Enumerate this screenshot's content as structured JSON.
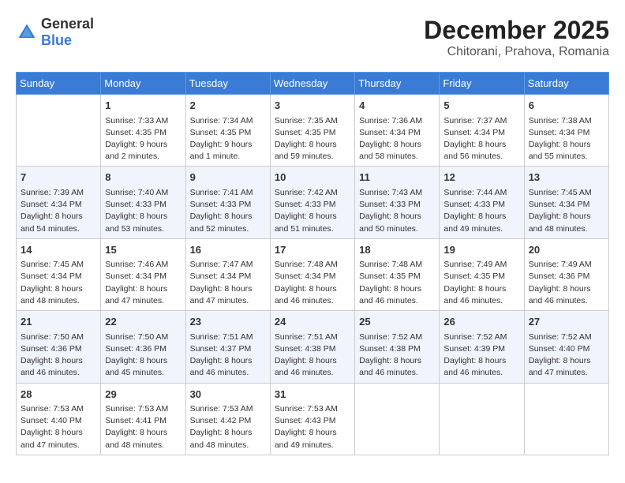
{
  "header": {
    "logo_general": "General",
    "logo_blue": "Blue",
    "main_title": "December 2025",
    "subtitle": "Chitorani, Prahova, Romania"
  },
  "days_of_week": [
    "Sunday",
    "Monday",
    "Tuesday",
    "Wednesday",
    "Thursday",
    "Friday",
    "Saturday"
  ],
  "weeks": [
    [
      {
        "day": "",
        "sunrise": "",
        "sunset": "",
        "daylight": ""
      },
      {
        "day": "1",
        "sunrise": "Sunrise: 7:33 AM",
        "sunset": "Sunset: 4:35 PM",
        "daylight": "Daylight: 9 hours and 2 minutes."
      },
      {
        "day": "2",
        "sunrise": "Sunrise: 7:34 AM",
        "sunset": "Sunset: 4:35 PM",
        "daylight": "Daylight: 9 hours and 1 minute."
      },
      {
        "day": "3",
        "sunrise": "Sunrise: 7:35 AM",
        "sunset": "Sunset: 4:35 PM",
        "daylight": "Daylight: 8 hours and 59 minutes."
      },
      {
        "day": "4",
        "sunrise": "Sunrise: 7:36 AM",
        "sunset": "Sunset: 4:34 PM",
        "daylight": "Daylight: 8 hours and 58 minutes."
      },
      {
        "day": "5",
        "sunrise": "Sunrise: 7:37 AM",
        "sunset": "Sunset: 4:34 PM",
        "daylight": "Daylight: 8 hours and 56 minutes."
      },
      {
        "day": "6",
        "sunrise": "Sunrise: 7:38 AM",
        "sunset": "Sunset: 4:34 PM",
        "daylight": "Daylight: 8 hours and 55 minutes."
      }
    ],
    [
      {
        "day": "7",
        "sunrise": "Sunrise: 7:39 AM",
        "sunset": "Sunset: 4:34 PM",
        "daylight": "Daylight: 8 hours and 54 minutes."
      },
      {
        "day": "8",
        "sunrise": "Sunrise: 7:40 AM",
        "sunset": "Sunset: 4:33 PM",
        "daylight": "Daylight: 8 hours and 53 minutes."
      },
      {
        "day": "9",
        "sunrise": "Sunrise: 7:41 AM",
        "sunset": "Sunset: 4:33 PM",
        "daylight": "Daylight: 8 hours and 52 minutes."
      },
      {
        "day": "10",
        "sunrise": "Sunrise: 7:42 AM",
        "sunset": "Sunset: 4:33 PM",
        "daylight": "Daylight: 8 hours and 51 minutes."
      },
      {
        "day": "11",
        "sunrise": "Sunrise: 7:43 AM",
        "sunset": "Sunset: 4:33 PM",
        "daylight": "Daylight: 8 hours and 50 minutes."
      },
      {
        "day": "12",
        "sunrise": "Sunrise: 7:44 AM",
        "sunset": "Sunset: 4:33 PM",
        "daylight": "Daylight: 8 hours and 49 minutes."
      },
      {
        "day": "13",
        "sunrise": "Sunrise: 7:45 AM",
        "sunset": "Sunset: 4:34 PM",
        "daylight": "Daylight: 8 hours and 48 minutes."
      }
    ],
    [
      {
        "day": "14",
        "sunrise": "Sunrise: 7:45 AM",
        "sunset": "Sunset: 4:34 PM",
        "daylight": "Daylight: 8 hours and 48 minutes."
      },
      {
        "day": "15",
        "sunrise": "Sunrise: 7:46 AM",
        "sunset": "Sunset: 4:34 PM",
        "daylight": "Daylight: 8 hours and 47 minutes."
      },
      {
        "day": "16",
        "sunrise": "Sunrise: 7:47 AM",
        "sunset": "Sunset: 4:34 PM",
        "daylight": "Daylight: 8 hours and 47 minutes."
      },
      {
        "day": "17",
        "sunrise": "Sunrise: 7:48 AM",
        "sunset": "Sunset: 4:34 PM",
        "daylight": "Daylight: 8 hours and 46 minutes."
      },
      {
        "day": "18",
        "sunrise": "Sunrise: 7:48 AM",
        "sunset": "Sunset: 4:35 PM",
        "daylight": "Daylight: 8 hours and 46 minutes."
      },
      {
        "day": "19",
        "sunrise": "Sunrise: 7:49 AM",
        "sunset": "Sunset: 4:35 PM",
        "daylight": "Daylight: 8 hours and 46 minutes."
      },
      {
        "day": "20",
        "sunrise": "Sunrise: 7:49 AM",
        "sunset": "Sunset: 4:36 PM",
        "daylight": "Daylight: 8 hours and 46 minutes."
      }
    ],
    [
      {
        "day": "21",
        "sunrise": "Sunrise: 7:50 AM",
        "sunset": "Sunset: 4:36 PM",
        "daylight": "Daylight: 8 hours and 46 minutes."
      },
      {
        "day": "22",
        "sunrise": "Sunrise: 7:50 AM",
        "sunset": "Sunset: 4:36 PM",
        "daylight": "Daylight: 8 hours and 45 minutes."
      },
      {
        "day": "23",
        "sunrise": "Sunrise: 7:51 AM",
        "sunset": "Sunset: 4:37 PM",
        "daylight": "Daylight: 8 hours and 46 minutes."
      },
      {
        "day": "24",
        "sunrise": "Sunrise: 7:51 AM",
        "sunset": "Sunset: 4:38 PM",
        "daylight": "Daylight: 8 hours and 46 minutes."
      },
      {
        "day": "25",
        "sunrise": "Sunrise: 7:52 AM",
        "sunset": "Sunset: 4:38 PM",
        "daylight": "Daylight: 8 hours and 46 minutes."
      },
      {
        "day": "26",
        "sunrise": "Sunrise: 7:52 AM",
        "sunset": "Sunset: 4:39 PM",
        "daylight": "Daylight: 8 hours and 46 minutes."
      },
      {
        "day": "27",
        "sunrise": "Sunrise: 7:52 AM",
        "sunset": "Sunset: 4:40 PM",
        "daylight": "Daylight: 8 hours and 47 minutes."
      }
    ],
    [
      {
        "day": "28",
        "sunrise": "Sunrise: 7:53 AM",
        "sunset": "Sunset: 4:40 PM",
        "daylight": "Daylight: 8 hours and 47 minutes."
      },
      {
        "day": "29",
        "sunrise": "Sunrise: 7:53 AM",
        "sunset": "Sunset: 4:41 PM",
        "daylight": "Daylight: 8 hours and 48 minutes."
      },
      {
        "day": "30",
        "sunrise": "Sunrise: 7:53 AM",
        "sunset": "Sunset: 4:42 PM",
        "daylight": "Daylight: 8 hours and 48 minutes."
      },
      {
        "day": "31",
        "sunrise": "Sunrise: 7:53 AM",
        "sunset": "Sunset: 4:43 PM",
        "daylight": "Daylight: 8 hours and 49 minutes."
      },
      {
        "day": "",
        "sunrise": "",
        "sunset": "",
        "daylight": ""
      },
      {
        "day": "",
        "sunrise": "",
        "sunset": "",
        "daylight": ""
      },
      {
        "day": "",
        "sunrise": "",
        "sunset": "",
        "daylight": ""
      }
    ]
  ]
}
